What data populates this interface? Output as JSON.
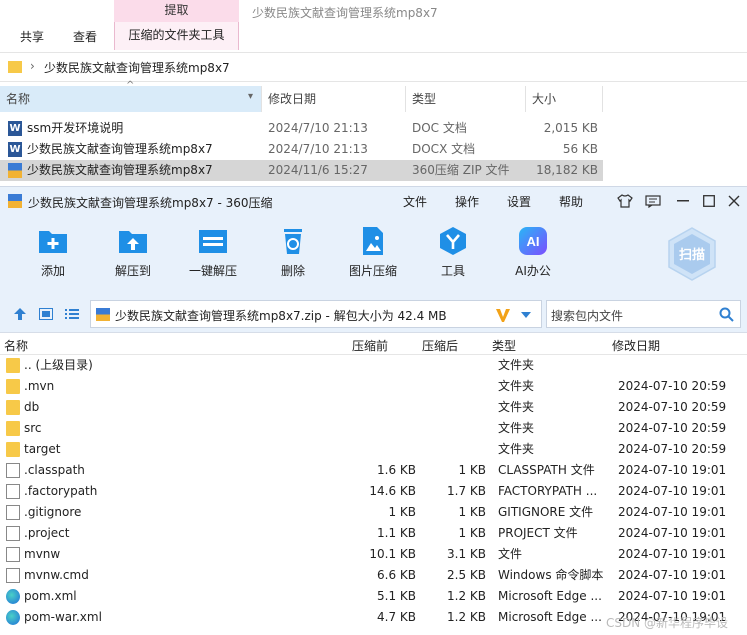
{
  "explorer": {
    "context_tab_header": "提取",
    "tabs": [
      "共享",
      "查看",
      "压缩的文件夹工具"
    ],
    "window_title": "少数民族文献查询管理系统mp8x7",
    "address_path": "少数民族文献查询管理系统mp8x7",
    "columns": [
      "名称",
      "修改日期",
      "类型",
      "大小"
    ],
    "files": [
      {
        "name": "ssm开发环境说明",
        "date": "2024/7/10 21:13",
        "type": "DOC 文档",
        "size": "2,015 KB",
        "icon": "word-icon"
      },
      {
        "name": "少数民族文献查询管理系统mp8x7",
        "date": "2024/7/10 21:13",
        "type": "DOCX 文档",
        "size": "56 KB",
        "icon": "word-icon"
      },
      {
        "name": "少数民族文献查询管理系统mp8x7",
        "date": "2024/11/6 15:27",
        "type": "360压缩 ZIP 文件",
        "size": "18,182 KB",
        "icon": "zip-icon"
      }
    ]
  },
  "zip": {
    "title": "少数民族文献查询管理系统mp8x7 - 360压缩",
    "menu": [
      "文件",
      "操作",
      "设置",
      "帮助"
    ],
    "toolbar": [
      {
        "label": "添加",
        "icon": "add-icon"
      },
      {
        "label": "解压到",
        "icon": "extract-to-icon"
      },
      {
        "label": "一键解压",
        "icon": "one-click-extract-icon"
      },
      {
        "label": "删除",
        "icon": "delete-icon"
      },
      {
        "label": "图片压缩",
        "icon": "image-compress-icon"
      },
      {
        "label": "工具",
        "icon": "tools-icon"
      },
      {
        "label": "AI办公",
        "icon": "ai-office-icon"
      }
    ],
    "scan_label": "扫描",
    "ai_badge": "AI",
    "path": "少数民族文献查询管理系统mp8x7.zip - 解包大小为 42.4 MB",
    "search_placeholder": "搜索包内文件",
    "columns": [
      "名称",
      "压缩前",
      "压缩后",
      "类型",
      "修改日期"
    ],
    "rows": [
      {
        "name": ".. (上级目录)",
        "before": "",
        "after": "",
        "type": "文件夹",
        "date": "",
        "icon": "folder"
      },
      {
        "name": ".mvn",
        "before": "",
        "after": "",
        "type": "文件夹",
        "date": "2024-07-10 20:59",
        "icon": "folder"
      },
      {
        "name": "db",
        "before": "",
        "after": "",
        "type": "文件夹",
        "date": "2024-07-10 20:59",
        "icon": "folder"
      },
      {
        "name": "src",
        "before": "",
        "after": "",
        "type": "文件夹",
        "date": "2024-07-10 20:59",
        "icon": "folder"
      },
      {
        "name": "target",
        "before": "",
        "after": "",
        "type": "文件夹",
        "date": "2024-07-10 20:59",
        "icon": "folder"
      },
      {
        "name": ".classpath",
        "before": "1.6 KB",
        "after": "1 KB",
        "type": "CLASSPATH 文件",
        "date": "2024-07-10 19:01",
        "icon": "file"
      },
      {
        "name": ".factorypath",
        "before": "14.6 KB",
        "after": "1.7 KB",
        "type": "FACTORYPATH ...",
        "date": "2024-07-10 19:01",
        "icon": "file"
      },
      {
        "name": ".gitignore",
        "before": "1 KB",
        "after": "1 KB",
        "type": "GITIGNORE 文件",
        "date": "2024-07-10 19:01",
        "icon": "file"
      },
      {
        "name": ".project",
        "before": "1.1 KB",
        "after": "1 KB",
        "type": "PROJECT 文件",
        "date": "2024-07-10 19:01",
        "icon": "file"
      },
      {
        "name": "mvnw",
        "before": "10.1 KB",
        "after": "3.1 KB",
        "type": "文件",
        "date": "2024-07-10 19:01",
        "icon": "file"
      },
      {
        "name": "mvnw.cmd",
        "before": "6.6 KB",
        "after": "2.5 KB",
        "type": "Windows 命令脚本",
        "date": "2024-07-10 19:01",
        "icon": "file"
      },
      {
        "name": "pom.xml",
        "before": "5.1 KB",
        "after": "1.2 KB",
        "type": "Microsoft Edge ...",
        "date": "2024-07-10 19:01",
        "icon": "edge"
      },
      {
        "name": "pom-war.xml",
        "before": "4.7 KB",
        "after": "1.2 KB",
        "type": "Microsoft Edge ...",
        "date": "2024-07-10 19:01",
        "icon": "edge"
      }
    ]
  },
  "watermark": "CSDN @新华程序毕设"
}
